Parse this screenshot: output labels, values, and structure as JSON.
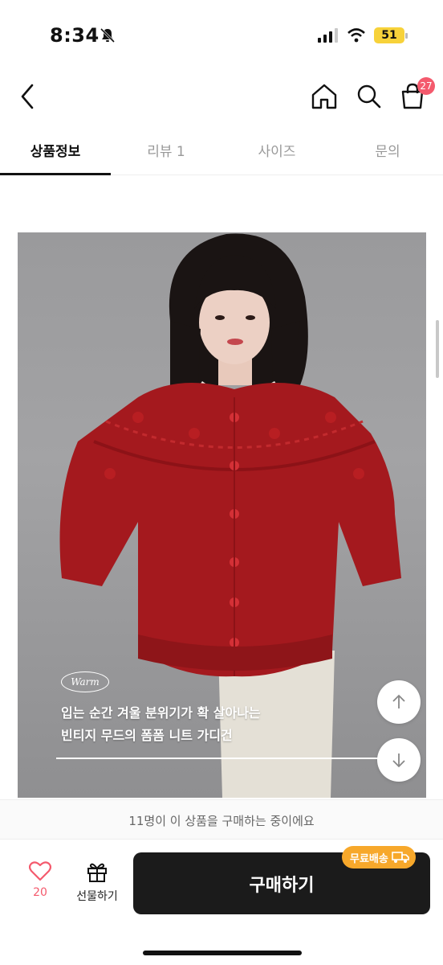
{
  "status_bar": {
    "time": "8:34",
    "battery": "51"
  },
  "header": {
    "cart_count": "27"
  },
  "tabs": [
    {
      "label": "상품정보",
      "active": true
    },
    {
      "label": "리뷰 1",
      "active": false
    },
    {
      "label": "사이즈",
      "active": false
    },
    {
      "label": "문의",
      "active": false
    }
  ],
  "product": {
    "badge": "Warm",
    "caption_line1": "입는 순간 겨울 분위기가 확 살아나는",
    "caption_line2": "빈티지 무드의 폼폼 니트 가디건"
  },
  "buying_notice": "11명이 이 상품을 구매하는 중이에요",
  "bottom_bar": {
    "like_count": "20",
    "gift_label": "선물하기",
    "buy_label": "구매하기",
    "free_shipping": "무료배송"
  },
  "colors": {
    "accent_red": "#f45a6d",
    "badge_orange": "#f7a82b",
    "buy_button": "#1b1b1b",
    "battery": "#f7d23a"
  },
  "icons": [
    "bell-slash-icon",
    "signal-icon",
    "wifi-icon",
    "battery-icon",
    "back-chevron-icon",
    "home-icon",
    "search-icon",
    "shopping-bag-icon",
    "arrow-up-icon",
    "arrow-down-icon",
    "heart-icon",
    "gift-icon",
    "truck-icon"
  ]
}
